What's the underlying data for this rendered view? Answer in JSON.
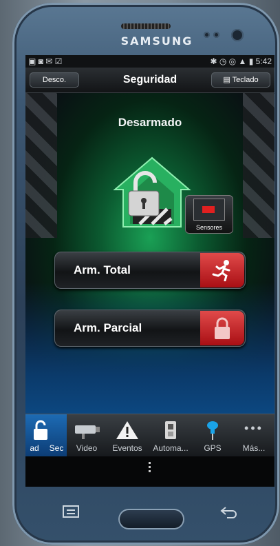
{
  "device": {
    "brand": "SAMSUNG"
  },
  "statusbar": {
    "time": "5:42",
    "left_icons": "▣ ◙ ✉ ☑",
    "right_icons": "✱ ◷ ◎ ▲ ▮"
  },
  "titlebar": {
    "left_button": "Desco.",
    "title": "Seguridad",
    "right_button": "Teclado"
  },
  "main": {
    "status": "Desarmado",
    "sensors_label": "Sensores",
    "arm_total_label": "Arm. Total",
    "arm_parcial_label": "Arm. Parcial"
  },
  "tabs": [
    {
      "label": "ad",
      "icon": "lock-icon"
    },
    {
      "label": "Sec",
      "icon": "lock-icon"
    },
    {
      "label": "Video",
      "icon": "camera-icon"
    },
    {
      "label": "Eventos",
      "icon": "warning-icon"
    },
    {
      "label": "Automa...",
      "icon": "switch-icon"
    },
    {
      "label": "GPS",
      "icon": "pin-icon"
    },
    {
      "label": "Más...",
      "icon": "more-icon"
    }
  ],
  "colors": {
    "accent_green": "#1aa055",
    "alarm_red": "#d0282d",
    "tab_active": "#1d6bb4"
  }
}
